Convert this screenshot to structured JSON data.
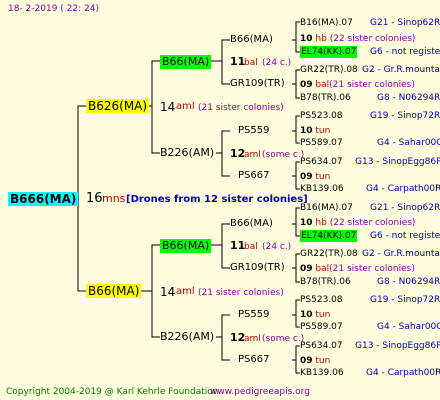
{
  "header": {
    "date": "18-  2-2019 (  22:  24)"
  },
  "footer": {
    "copyright": "Copyright 2004-2019 @ Karl Kehrle Foundation",
    "website": "www.pedigreeapis.org"
  },
  "root": {
    "name": "B666(MA)",
    "year": "16",
    "year_suffix": "mns",
    "note": "[Drones from 12 sister colonies]"
  },
  "gen1": [
    {
      "name": "B626(MA)",
      "year": "14",
      "suffix": "aml",
      "note": "(21 sister colonies)"
    },
    {
      "name": "B66(MA)",
      "year": "14",
      "suffix": "aml",
      "note": "(21 sister colonies)"
    }
  ],
  "gen2": [
    {
      "name": "B66(MA)",
      "year": "11",
      "suffix": "bal",
      "note": "(24 c.)"
    },
    {
      "name": "B226(AM)",
      "year": "12",
      "suffix": "aml",
      "note": "(some c.)"
    },
    {
      "name": "B66(MA)",
      "year": "11",
      "suffix": "bal",
      "note": "(24 c.)"
    },
    {
      "name": "B226(AM)",
      "year": "12",
      "suffix": "aml",
      "note": "(some c.)"
    }
  ],
  "gen3": [
    {
      "name": "B66(MA)",
      "year": "10",
      "suffix": "hb",
      "note": "(22 sister colonies)"
    },
    {
      "name": "GR109(TR)",
      "year": "09",
      "suffix": "bal",
      "note": "(21 sister colonies)"
    },
    {
      "name": "PS559",
      "year": "10",
      "suffix": "tun",
      "note": ""
    },
    {
      "name": "PS667",
      "year": "09",
      "suffix": "tun",
      "note": ""
    },
    {
      "name": "B66(MA)",
      "year": "10",
      "suffix": "hb",
      "note": "(22 sister colonies)"
    },
    {
      "name": "GR109(TR)",
      "year": "09",
      "suffix": "bal",
      "note": "(21 sister colonies)"
    },
    {
      "name": "PS559",
      "year": "10",
      "suffix": "tun",
      "note": ""
    },
    {
      "name": "PS667",
      "year": "09",
      "suffix": "tun",
      "note": ""
    }
  ],
  "gen4": [
    {
      "name": "B16(MA).07",
      "code": "G21 - Sinop62R"
    },
    {
      "name": "EL74(KK).07",
      "code": "G6 - not registe"
    },
    {
      "name": "GR22(TR).08",
      "code": "G2 - Gr.R.mounta"
    },
    {
      "name": "B78(TR).06",
      "code": "G8 - N06294R"
    },
    {
      "name": "PS523.08",
      "code": "G19 - Sinop72R"
    },
    {
      "name": "PS589.07",
      "code": "G4 - Sahar00Q"
    },
    {
      "name": "PS634.07",
      "code": "G13 - SinopEgg86R"
    },
    {
      "name": "KB139.06",
      "code": "G4 - Carpath00R"
    },
    {
      "name": "B16(MA).07",
      "code": "G21 - Sinop62R"
    },
    {
      "name": "EL74(KK).07",
      "code": "G6 - not registe"
    },
    {
      "name": "GR22(TR).08",
      "code": "G2 - Gr.R.mounta"
    },
    {
      "name": "B78(TR).06",
      "code": "G8 - N06294R"
    },
    {
      "name": "PS523.08",
      "code": "G19 - Sinop72R"
    },
    {
      "name": "PS589.07",
      "code": "G4 - Sahar00Q"
    },
    {
      "name": "PS634.07",
      "code": "G13 - SinopEgg86R"
    },
    {
      "name": "KB139.06",
      "code": "G4 - Carpath00R"
    }
  ]
}
